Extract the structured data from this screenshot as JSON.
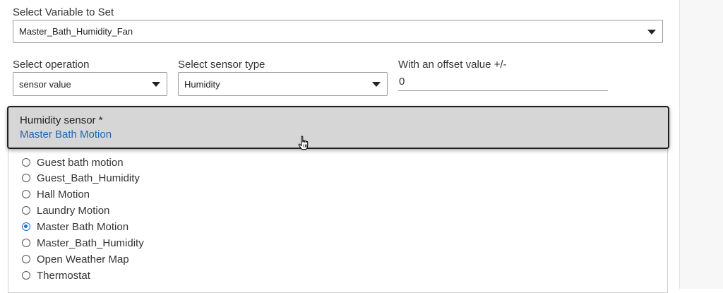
{
  "variable": {
    "label": "Select Variable to Set",
    "selected": "Master_Bath_Humidity_Fan"
  },
  "operation": {
    "label": "Select operation",
    "selected": "sensor value"
  },
  "sensor_type": {
    "label": "Select sensor type",
    "selected": "Humidity"
  },
  "offset": {
    "label": "With an offset value +/-",
    "value": "0"
  },
  "humidity_sensor": {
    "title": "Humidity sensor *",
    "selected": "Master Bath Motion"
  },
  "devices": [
    {
      "label": "Guest bath motion",
      "checked": false
    },
    {
      "label": "Guest_Bath_Humidity",
      "checked": false
    },
    {
      "label": "Hall Motion",
      "checked": false
    },
    {
      "label": "Laundry Motion",
      "checked": false
    },
    {
      "label": "Master Bath Motion",
      "checked": true
    },
    {
      "label": "Master_Bath_Humidity",
      "checked": false
    },
    {
      "label": "Open Weather Map",
      "checked": false
    },
    {
      "label": "Thermostat",
      "checked": false
    }
  ],
  "colors": {
    "accent": "#1a6fc9",
    "link": "#2566b0",
    "popup_bg": "#d6d6d6"
  }
}
